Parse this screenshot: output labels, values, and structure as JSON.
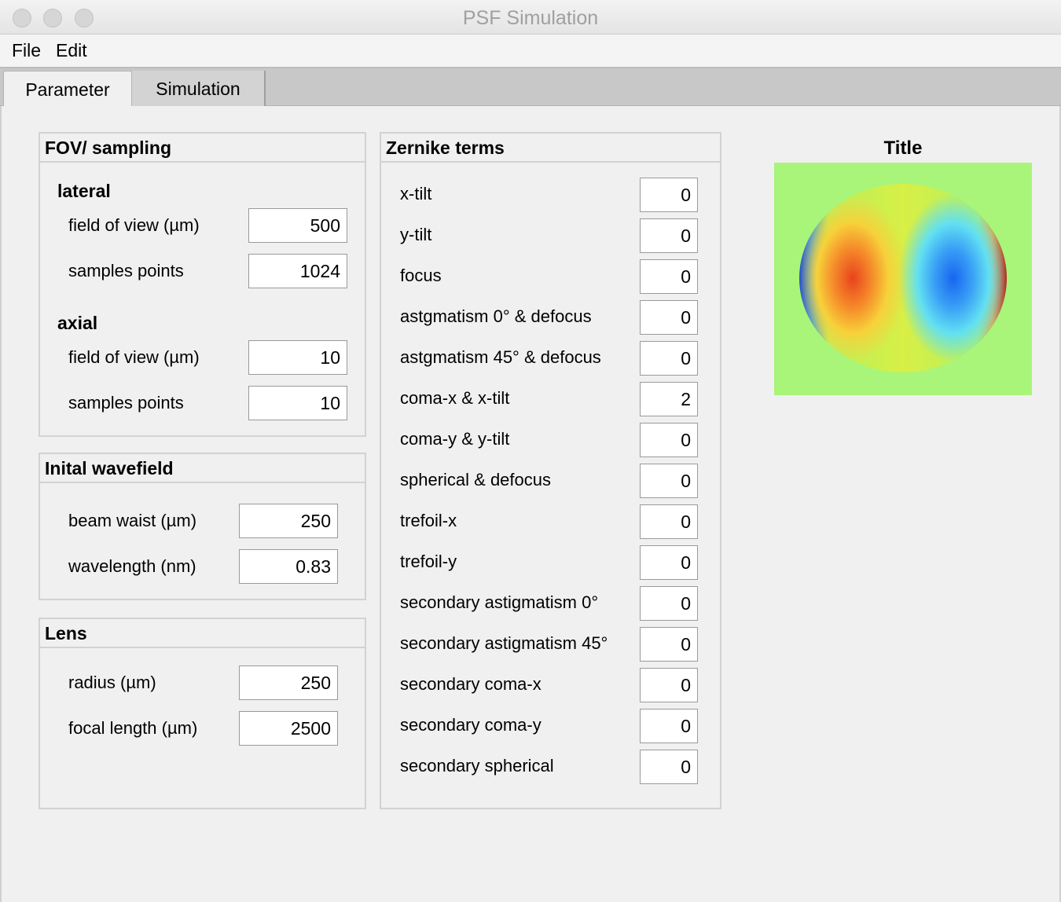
{
  "window": {
    "title": "PSF Simulation"
  },
  "menu": {
    "file": "File",
    "edit": "Edit"
  },
  "tabs": {
    "parameter": "Parameter",
    "simulation": "Simulation"
  },
  "fov": {
    "title": "FOV/ sampling",
    "lateral": {
      "heading": "lateral",
      "fov_label": "field of view (µm)",
      "fov_value": "500",
      "samples_label": "samples points",
      "samples_value": "1024"
    },
    "axial": {
      "heading": "axial",
      "fov_label": "field of view (µm)",
      "fov_value": "10",
      "samples_label": "samples points",
      "samples_value": "10"
    }
  },
  "wavefield": {
    "title": "Inital wavefield",
    "waist_label": "beam waist (µm)",
    "waist_value": "250",
    "wavelength_label": "wavelength (nm)",
    "wavelength_value": "0.83"
  },
  "lens": {
    "title": "Lens",
    "radius_label": "radius (µm)",
    "radius_value": "250",
    "focal_label": "focal length (µm)",
    "focal_value": "2500"
  },
  "zernike": {
    "title": "Zernike terms",
    "terms": [
      {
        "label": "x-tilt",
        "value": "0"
      },
      {
        "label": "y-tilt",
        "value": "0"
      },
      {
        "label": "focus",
        "value": "0"
      },
      {
        "label": "astgmatism 0° & defocus",
        "value": "0"
      },
      {
        "label": "astgmatism 45° & defocus",
        "value": "0"
      },
      {
        "label": "coma-x & x-tilt",
        "value": "2"
      },
      {
        "label": "coma-y & y-tilt",
        "value": "0"
      },
      {
        "label": "spherical & defocus",
        "value": "0"
      },
      {
        "label": "trefoil-x",
        "value": "0"
      },
      {
        "label": "trefoil-y",
        "value": "0"
      },
      {
        "label": "secondary astigmatism 0°",
        "value": "0"
      },
      {
        "label": "secondary astigmatism 45°",
        "value": "0"
      },
      {
        "label": "secondary coma-x",
        "value": "0"
      },
      {
        "label": "secondary coma-y",
        "value": "0"
      },
      {
        "label": "secondary spherical",
        "value": "0"
      }
    ]
  },
  "plot": {
    "title": "Title",
    "colormap": "jet",
    "background_color": "#a8f57a",
    "warm_lobe_color": "#e8431e",
    "cool_lobe_color": "#1765f0"
  }
}
